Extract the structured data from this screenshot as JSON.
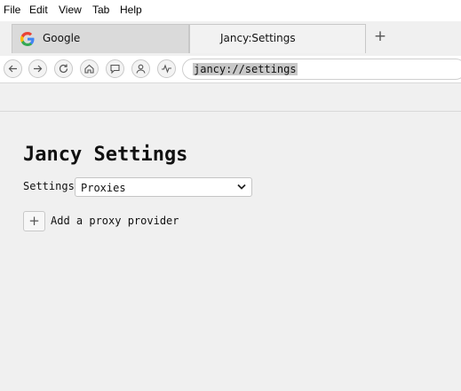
{
  "menubar": {
    "items": [
      "File",
      "Edit",
      "View",
      "Tab",
      "Help"
    ]
  },
  "tabs": [
    {
      "title": "Google",
      "icon": "google-favicon",
      "active": false
    },
    {
      "title": "Jancy:Settings",
      "icon": "",
      "active": true
    }
  ],
  "new_tab_label": "+",
  "toolbar": {
    "buttons": [
      "back-icon",
      "forward-icon",
      "reload-icon",
      "home-icon",
      "chat-icon",
      "profile-icon",
      "activity-icon"
    ],
    "url": "jancy://settings"
  },
  "page": {
    "title": "Jancy Settings",
    "settings_label": "Settings",
    "settings_select": {
      "value": "Proxies"
    },
    "add_button_icon": "+",
    "add_label": "Add a proxy provider"
  },
  "colors": {
    "background": "#f0f0f0",
    "menubar": "#ffffff",
    "url_highlight": "#c8c8c8"
  }
}
